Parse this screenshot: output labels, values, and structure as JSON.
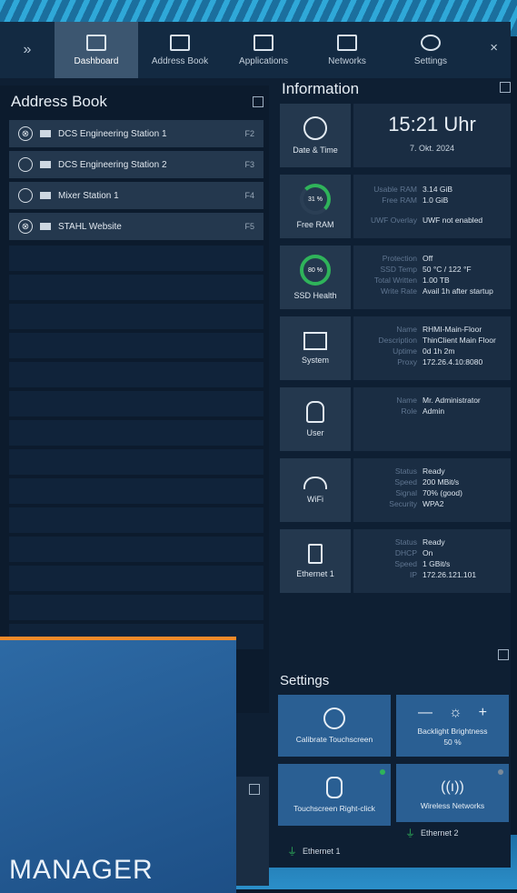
{
  "nav": {
    "expand": "»",
    "items": [
      {
        "label": "Dashboard"
      },
      {
        "label": "Address Book"
      },
      {
        "label": "Applications"
      },
      {
        "label": "Networks"
      },
      {
        "label": "Settings"
      }
    ],
    "close": "×"
  },
  "address_book": {
    "title": "Address Book",
    "rows": [
      {
        "name": "DCS Engineering Station 1",
        "key": "F2",
        "state": "⊗"
      },
      {
        "name": "DCS Engineering Station 2",
        "key": "F3",
        "state": ""
      },
      {
        "name": "Mixer Station 1",
        "key": "F4",
        "state": ""
      },
      {
        "name": "STAHL Website",
        "key": "F5",
        "state": "⊗"
      }
    ]
  },
  "overlay": {
    "brand": "MANAGER"
  },
  "information": {
    "title": "Information",
    "datetime": {
      "label": "Date & Time",
      "time": "15:21 Uhr",
      "date": "7. Okt. 2024"
    },
    "ram": {
      "label": "Free RAM",
      "percent": "31 %",
      "rows": [
        {
          "k": "Usable RAM",
          "v": "3.14 GiB"
        },
        {
          "k": "Free RAM",
          "v": "1.0 GiB"
        },
        {
          "k": "UWF Overlay",
          "v": "UWF not enabled"
        }
      ]
    },
    "ssd": {
      "label": "SSD Health",
      "percent": "80 %",
      "rows": [
        {
          "k": "Protection",
          "v": "Off"
        },
        {
          "k": "SSD Temp",
          "v": "50 °C / 122 °F"
        },
        {
          "k": "Total Written",
          "v": "1.00 TB"
        },
        {
          "k": "Write Rate",
          "v": "Avail 1h after startup"
        }
      ]
    },
    "system": {
      "label": "System",
      "rows": [
        {
          "k": "Name",
          "v": "RHMI-Main-Floor"
        },
        {
          "k": "Description",
          "v": "ThinClient Main Floor"
        },
        {
          "k": "Uptime",
          "v": "0d 1h 2m"
        },
        {
          "k": "Proxy",
          "v": "172.26.4.10:8080"
        }
      ]
    },
    "user": {
      "label": "User",
      "rows": [
        {
          "k": "Name",
          "v": "Mr. Administrator"
        },
        {
          "k": "Role",
          "v": "Admin"
        }
      ]
    },
    "wifi": {
      "label": "WiFi",
      "rows": [
        {
          "k": "Status",
          "v": "Ready"
        },
        {
          "k": "Speed",
          "v": "200 MBit/s"
        },
        {
          "k": "Signal",
          "v": "70% (good)"
        },
        {
          "k": "Security",
          "v": "WPA2"
        }
      ]
    },
    "ethernet": {
      "label": "Ethernet 1",
      "rows": [
        {
          "k": "Status",
          "v": "Ready"
        },
        {
          "k": "DHCP",
          "v": "On"
        },
        {
          "k": "Speed",
          "v": "1 GBit/s"
        },
        {
          "k": "IP",
          "v": "172.26.121.101"
        }
      ]
    }
  },
  "settings": {
    "title": "Settings",
    "calibrate": "Calibrate Touchscreen",
    "brightness": {
      "label": "Backlight Brightness",
      "value": "50 %",
      "minus": "—",
      "plus": "+"
    },
    "rightclick": "Touchscreen Right-click",
    "wireless": "Wireless Networks",
    "eth1": "Ethernet 1",
    "eth2": "Ethernet 2"
  },
  "colors": {
    "accent": "#2a5f93",
    "ok": "#2fb35a",
    "brand_stripe": "#f08a2a"
  }
}
